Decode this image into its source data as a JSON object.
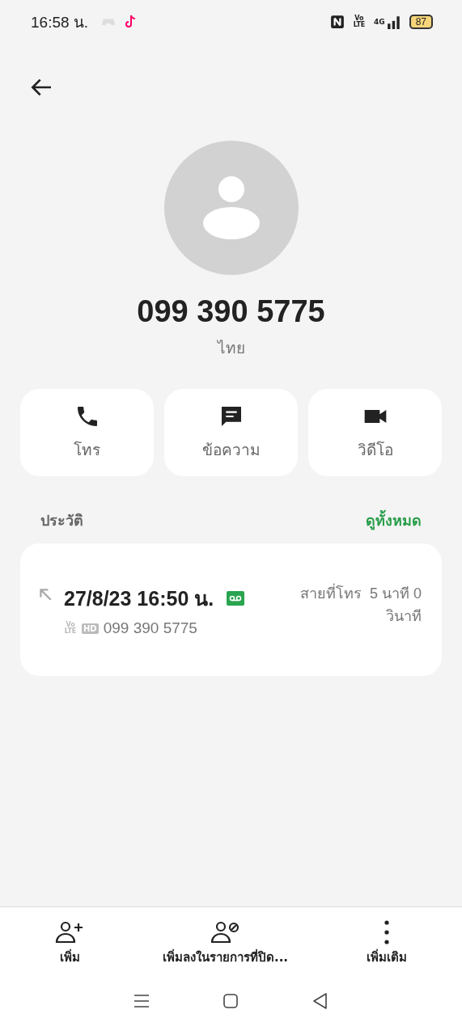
{
  "status_bar": {
    "time": "16:58 น.",
    "volte": "Vo LTE",
    "network": "4G",
    "battery": "87"
  },
  "contact": {
    "number": "099 390 5775",
    "location": "ไทย"
  },
  "actions": [
    {
      "kind": "call",
      "label": "โทร"
    },
    {
      "kind": "message",
      "label": "ข้อความ"
    },
    {
      "kind": "video",
      "label": "วิดีโอ"
    }
  ],
  "history": {
    "title": "ประวัติ",
    "see_all": "ดูทั้งหมด",
    "entries": [
      {
        "datetime": "27/8/23 16:50 น.",
        "recorded": true,
        "volte": "Vo LTE",
        "hd": "HD",
        "number": "099 390 5775",
        "type": "สายที่โทร",
        "duration": "5 นาที 0 วินาที"
      }
    ]
  },
  "bottom_actions": [
    {
      "kind": "add",
      "label": "เพิ่ม"
    },
    {
      "kind": "block",
      "label": "เพิ่มลงในรายการที่ปิด..."
    },
    {
      "kind": "more",
      "label": "เพิ่มเติม"
    }
  ]
}
